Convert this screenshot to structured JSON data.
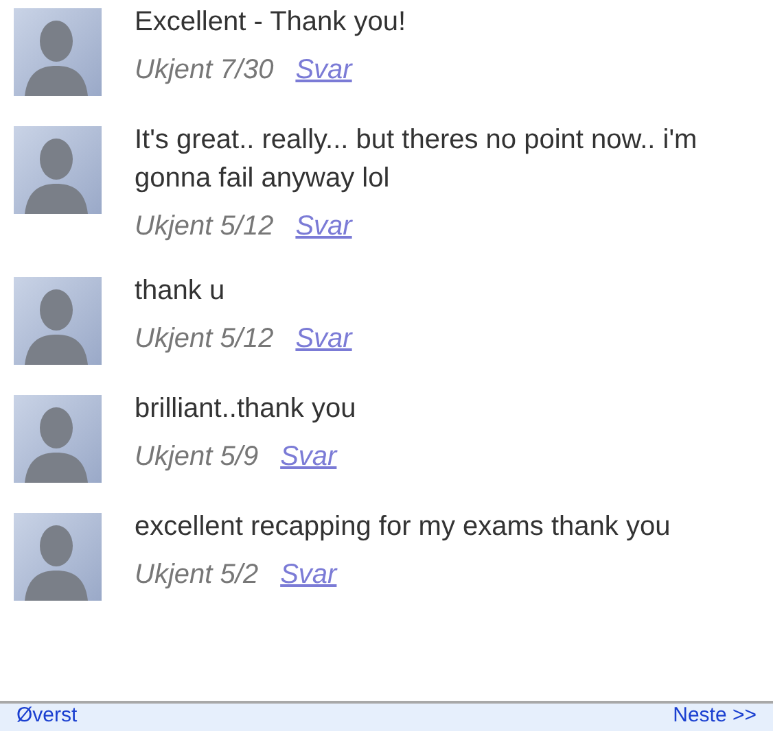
{
  "comments": [
    {
      "text": "Excellent - Thank you!",
      "author": "Ukjent",
      "date": "7/30",
      "reply": "Svar"
    },
    {
      "text": "It's great.. really... but theres no point now.. i'm gonna fail anyway lol",
      "author": "Ukjent",
      "date": "5/12",
      "reply": "Svar"
    },
    {
      "text": "thank u",
      "author": "Ukjent",
      "date": "5/12",
      "reply": "Svar"
    },
    {
      "text": "brilliant..thank you",
      "author": "Ukjent",
      "date": "5/9",
      "reply": "Svar"
    },
    {
      "text": "excellent recapping for my exams thank you",
      "author": "Ukjent",
      "date": "5/2",
      "reply": "Svar"
    }
  ],
  "pager": {
    "first": "Øverst",
    "next": "Neste >>"
  }
}
